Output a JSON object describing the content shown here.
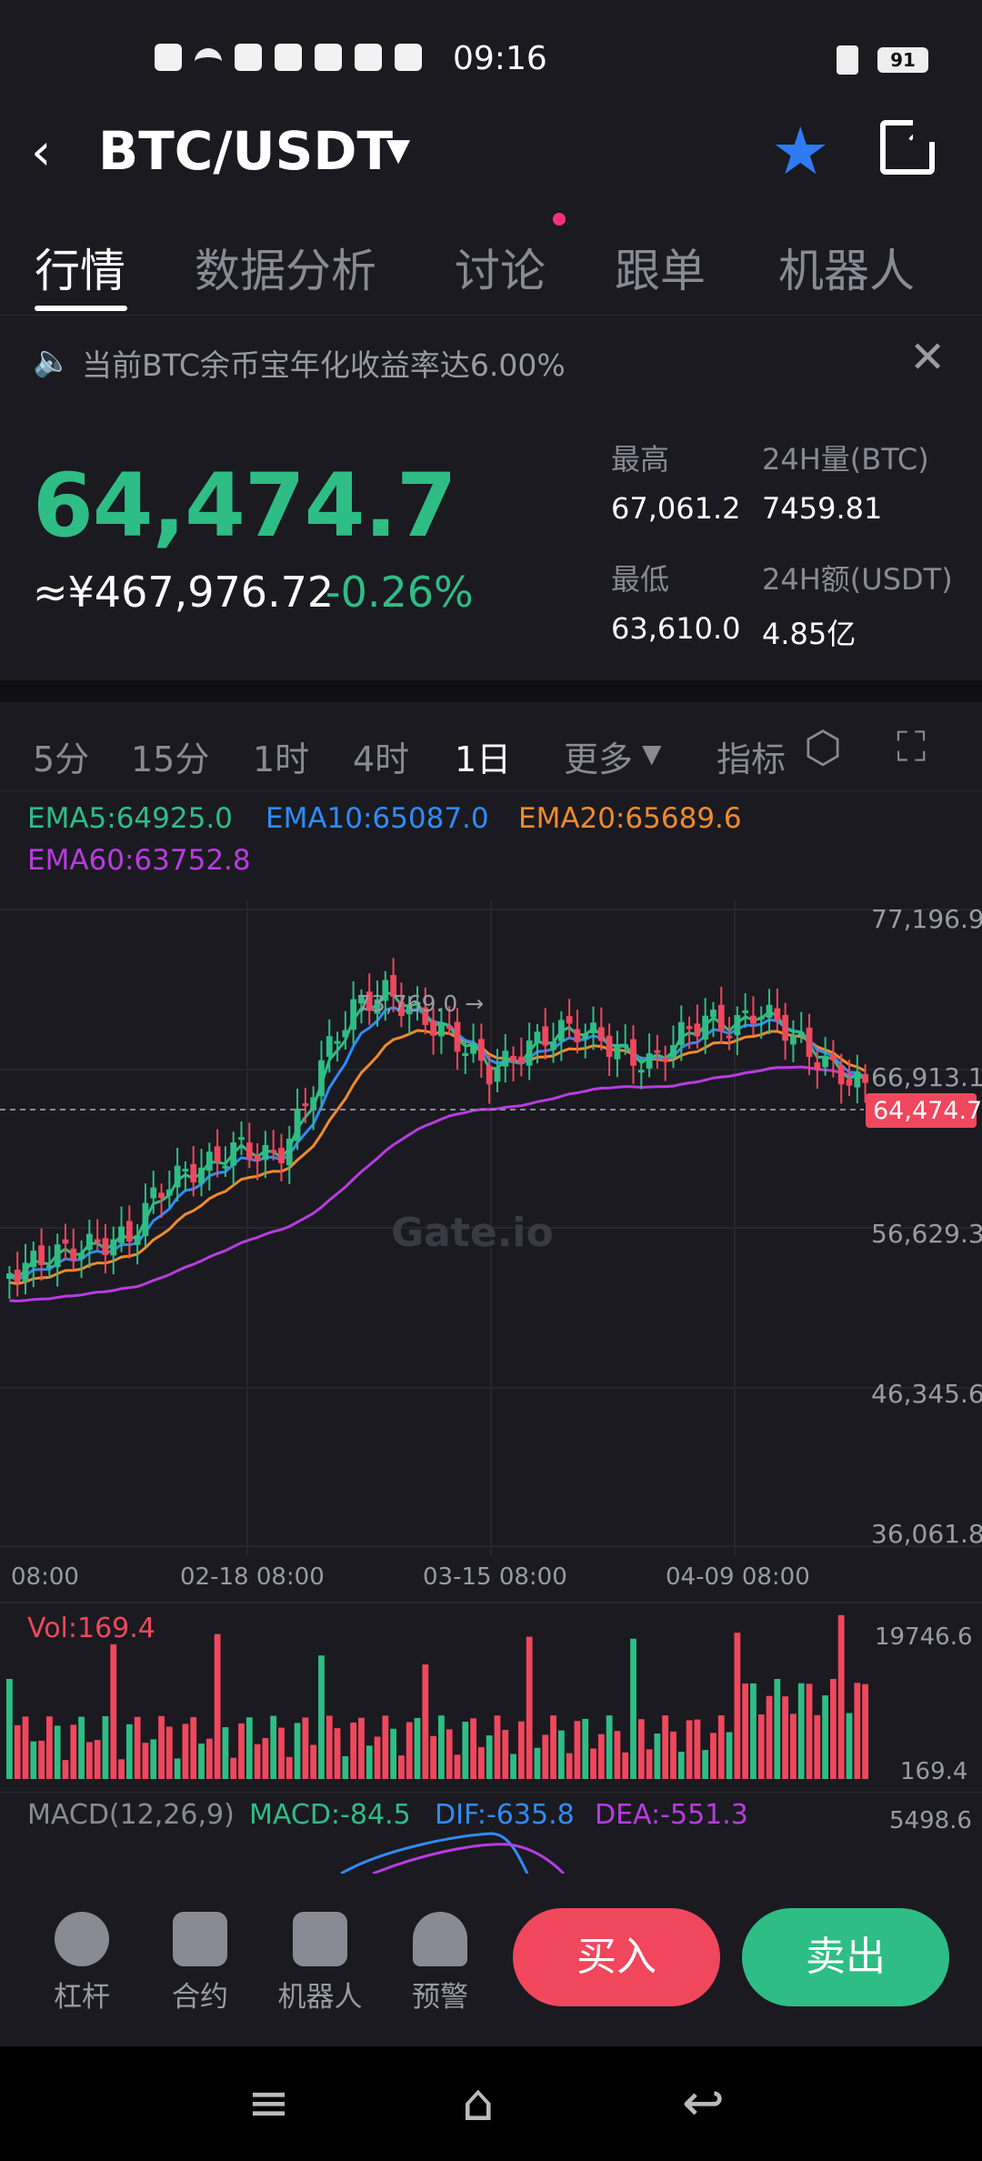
{
  "status": {
    "time": "09:16",
    "battery": "91"
  },
  "header": {
    "pair": "BTC/USDT"
  },
  "tabs": [
    "行情",
    "数据分析",
    "讨论",
    "跟单",
    "机器人"
  ],
  "notice": {
    "text": "当前BTC余币宝年化收益率达6.00%"
  },
  "ticker": {
    "price": "64,474.7",
    "cny": "≈¥467,976.72",
    "change": "-0.26%",
    "high_label": "最高",
    "high": "67,061.2",
    "low_label": "最低",
    "low": "63,610.0",
    "vol_label": "24H量(BTC)",
    "vol": "7459.81",
    "amt_label": "24H额(USDT)",
    "amt": "4.85亿"
  },
  "intervals": [
    "5分",
    "15分",
    "1时",
    "4时",
    "1日",
    "更多",
    "指标"
  ],
  "ema": {
    "ema5": "EMA5:64925.0",
    "ema10": "EMA10:65087.0",
    "ema20": "EMA20:65689.6",
    "ema60": "EMA60:63752.8"
  },
  "chart_labels": {
    "y_ticks": [
      "77,196.9",
      "66,913.1",
      "56,629.3",
      "46,345.6",
      "36,061.8"
    ],
    "x_ticks": [
      "08:00",
      "02-18 08:00",
      "03-15 08:00",
      "04-09 08:00"
    ],
    "max_marker": "73,769.0 →",
    "current_price": "64,474.7",
    "watermark": "Gate.io"
  },
  "volume": {
    "label": "Vol:169.4",
    "max": "19746.6",
    "min": "169.4"
  },
  "macd": {
    "label": "MACD(12,26,9)",
    "macd": "MACD:-84.5",
    "dif": "DIF:-635.8",
    "dea": "DEA:-551.3",
    "max": "5498.6"
  },
  "bottom": {
    "items": [
      "杠杆",
      "合约",
      "机器人",
      "预警"
    ],
    "buy": "买入",
    "sell": "卖出"
  },
  "colors": {
    "up": "#2ebd85",
    "down": "#f0475d",
    "ema5": "#2ebd85",
    "ema10": "#2f8cf6",
    "ema20": "#f08a2e",
    "ema60": "#b83ce0"
  }
}
